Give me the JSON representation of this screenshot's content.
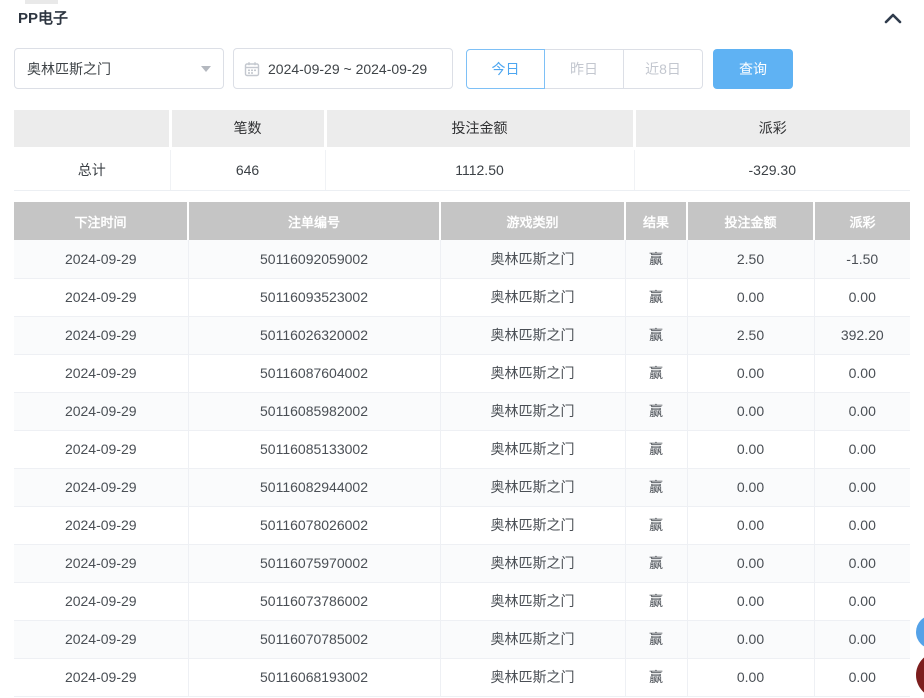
{
  "header": {
    "title": "PP电子"
  },
  "filters": {
    "game_select": {
      "value": "奥林匹斯之门"
    },
    "date_range": {
      "value": "2024-09-29 ~ 2024-09-29"
    },
    "quick_buttons": [
      {
        "label": "今日",
        "active": true
      },
      {
        "label": "昨日",
        "active": false
      },
      {
        "label": "近8日",
        "active": false
      }
    ],
    "search_label": "查询"
  },
  "summary": {
    "headers": {
      "blank": "",
      "count": "笔数",
      "bet_amount": "投注金额",
      "payout": "派彩"
    },
    "total_row": {
      "label": "总计",
      "count": "646",
      "bet_amount": "1112.50",
      "payout": "-329.30"
    }
  },
  "table": {
    "headers": [
      "下注时间",
      "注单编号",
      "游戏类别",
      "结果",
      "投注金额",
      "派彩"
    ],
    "rows": [
      {
        "time": "2024-09-29",
        "order_no": "50116092059002",
        "game": "奥林匹斯之门",
        "result": "赢",
        "bet": "2.50",
        "payout": "-1.50"
      },
      {
        "time": "2024-09-29",
        "order_no": "50116093523002",
        "game": "奥林匹斯之门",
        "result": "赢",
        "bet": "0.00",
        "payout": "0.00"
      },
      {
        "time": "2024-09-29",
        "order_no": "50116026320002",
        "game": "奥林匹斯之门",
        "result": "赢",
        "bet": "2.50",
        "payout": "392.20"
      },
      {
        "time": "2024-09-29",
        "order_no": "50116087604002",
        "game": "奥林匹斯之门",
        "result": "赢",
        "bet": "0.00",
        "payout": "0.00"
      },
      {
        "time": "2024-09-29",
        "order_no": "50116085982002",
        "game": "奥林匹斯之门",
        "result": "赢",
        "bet": "0.00",
        "payout": "0.00"
      },
      {
        "time": "2024-09-29",
        "order_no": "50116085133002",
        "game": "奥林匹斯之门",
        "result": "赢",
        "bet": "0.00",
        "payout": "0.00"
      },
      {
        "time": "2024-09-29",
        "order_no": "50116082944002",
        "game": "奥林匹斯之门",
        "result": "赢",
        "bet": "0.00",
        "payout": "0.00"
      },
      {
        "time": "2024-09-29",
        "order_no": "50116078026002",
        "game": "奥林匹斯之门",
        "result": "赢",
        "bet": "0.00",
        "payout": "0.00"
      },
      {
        "time": "2024-09-29",
        "order_no": "50116075970002",
        "game": "奥林匹斯之门",
        "result": "赢",
        "bet": "0.00",
        "payout": "0.00"
      },
      {
        "time": "2024-09-29",
        "order_no": "50116073786002",
        "game": "奥林匹斯之门",
        "result": "赢",
        "bet": "0.00",
        "payout": "0.00"
      },
      {
        "time": "2024-09-29",
        "order_no": "50116070785002",
        "game": "奥林匹斯之门",
        "result": "赢",
        "bet": "0.00",
        "payout": "0.00"
      },
      {
        "time": "2024-09-29",
        "order_no": "50116068193002",
        "game": "奥林匹斯之门",
        "result": "赢",
        "bet": "0.00",
        "payout": "0.00"
      }
    ]
  },
  "colors": {
    "accent_blue": "#5fb2f3",
    "negative_red": "#f25c5c",
    "table_header_bg": "#c5c5c5",
    "summary_header_bg": "#ececec"
  }
}
